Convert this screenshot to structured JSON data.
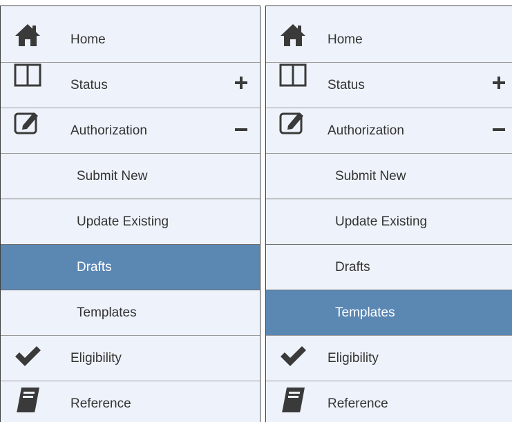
{
  "menus": [
    {
      "items": [
        {
          "label": "Home",
          "icon": "home-icon"
        },
        {
          "label": "Status",
          "icon": "columns-icon",
          "toggle": "+"
        },
        {
          "label": "Authorization",
          "icon": "edit-icon",
          "toggle": "−",
          "expanded": true
        },
        {
          "label": "Submit New"
        },
        {
          "label": "Update Existing"
        },
        {
          "label": "Drafts",
          "selected": true
        },
        {
          "label": "Templates"
        },
        {
          "label": "Eligibility",
          "icon": "check-icon"
        },
        {
          "label": "Reference",
          "icon": "book-icon"
        }
      ]
    },
    {
      "items": [
        {
          "label": "Home",
          "icon": "home-icon"
        },
        {
          "label": "Status",
          "icon": "columns-icon",
          "toggle": "+"
        },
        {
          "label": "Authorization",
          "icon": "edit-icon",
          "toggle": "−",
          "expanded": true
        },
        {
          "label": "Submit New"
        },
        {
          "label": "Update Existing"
        },
        {
          "label": "Drafts"
        },
        {
          "label": "Templates",
          "selected": true
        },
        {
          "label": "Eligibility",
          "icon": "check-icon"
        },
        {
          "label": "Reference",
          "icon": "book-icon"
        }
      ]
    }
  ],
  "colors": {
    "panel_background": "#eef3fb",
    "selected_background": "#5b87b3",
    "icon": "#3a3a3a",
    "text": "#333333",
    "selected_text": "#ffffff"
  }
}
